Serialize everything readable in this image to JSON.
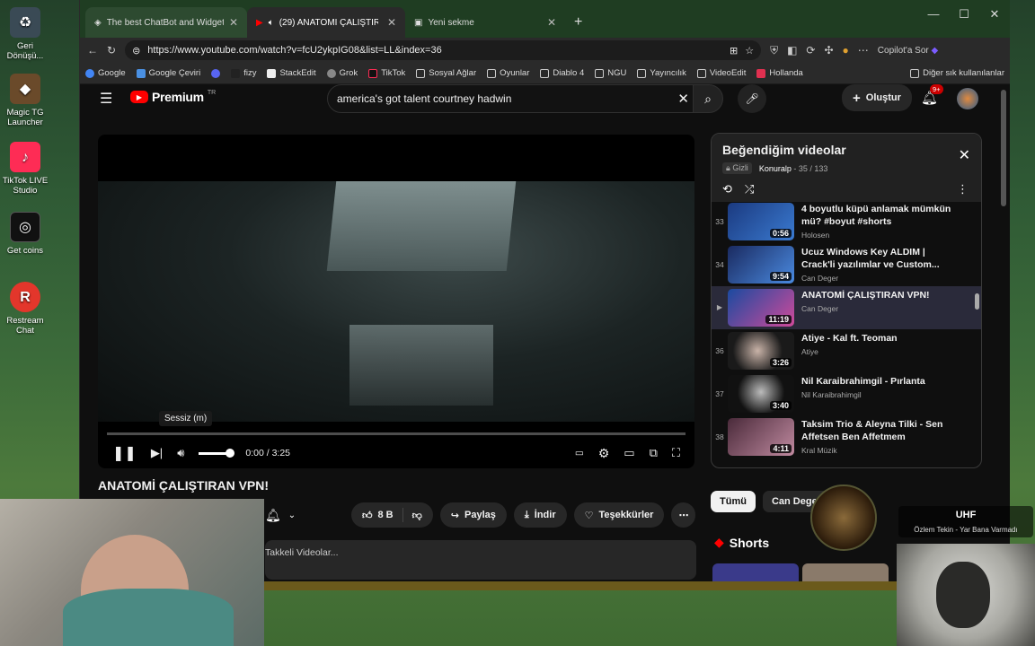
{
  "desktop": {
    "icons": [
      {
        "label": "Geri\nDönüşü...",
        "icon": "recycle-bin-icon"
      },
      {
        "label": "Magic TG\nLauncher",
        "icon": "magic-tg-icon"
      },
      {
        "label": "TikTok LIVE\nStudio",
        "icon": "tiktok-icon"
      },
      {
        "label": "Get coins",
        "icon": "tiktok-coins-icon"
      },
      {
        "label": "Restream\nChat",
        "icon": "restream-icon"
      }
    ]
  },
  "browser": {
    "tabs": [
      {
        "title": "The best ChatBot and Widgets fo"
      },
      {
        "title": "(29) ANATOMİ ÇALIŞTIRAN V"
      },
      {
        "title": "Yeni sekme"
      }
    ],
    "url": "https://www.youtube.com/watch?v=fcU2ykpIG08&list=LL&index=36",
    "copilot": "Copilot'a Sor",
    "bookmarks": [
      "Google",
      "Google Çeviri",
      "fizy",
      "StackEdit",
      "Grok",
      "TikTok",
      "Sosyal Ağlar",
      "Oyunlar",
      "Diablo 4",
      "NGU",
      "Yayıncılık",
      "VideoEdit",
      "Hollanda"
    ],
    "other_bookmarks": "Diğer sık kullanılanlar"
  },
  "youtube": {
    "logo": "Premium",
    "logo_region": "TR",
    "search_query": "america's got talent courtney hadwin",
    "create_label": "Oluştur",
    "notif_badge": "9+",
    "video": {
      "title": "ANATOMİ ÇALIŞTIRAN VPN!",
      "time": "0:00 / 3:25",
      "tooltip": "Sessiz (m)",
      "progress": 0,
      "volume": 0.9
    },
    "actions": {
      "likes": "8 B",
      "share": "Paylaş",
      "download": "İndir",
      "thanks": "Teşekkürler"
    },
    "description_snippet": "Takkeli Videolar...",
    "playlist": {
      "title": "Beğendiğim videolar",
      "privacy": "Gizli",
      "owner": "Konuralp",
      "position": "35 / 133",
      "items": [
        {
          "idx": "33",
          "title": "4 boyutlu küpü anlamak mümkün mü? #boyut #shorts",
          "channel": "Holosen",
          "duration": "0:56",
          "color": "#2a5db0"
        },
        {
          "idx": "34",
          "title": "Ucuz Windows Key ALDIM | Crack'li yazılımlar ve Custom...",
          "channel": "Can Deger",
          "duration": "9:54",
          "color": "#3a6ac8"
        },
        {
          "idx": "▶",
          "title": "ANATOMİ ÇALIŞTIRAN VPN!",
          "channel": "Can Deger",
          "duration": "11:19",
          "color": "#c03a8a"
        },
        {
          "idx": "36",
          "title": "Atiye - Kal ft. Teoman",
          "channel": "Atiye",
          "duration": "3:26",
          "color": "#1a1a1a"
        },
        {
          "idx": "37",
          "title": "Nil Karaibrahimgil - Pırlanta",
          "channel": "Nil Karaibrahimgil",
          "duration": "3:40",
          "color": "#2b2b2b"
        },
        {
          "idx": "38",
          "title": "Taksim Trio & Aleyna Tilki - Sen Affetsen Ben Affetmem",
          "channel": "Kral Müzik",
          "duration": "4:11",
          "color": "#6a3a5a"
        }
      ]
    },
    "chips": [
      "Tümü",
      "Can Deger"
    ],
    "shorts_label": "Shorts"
  },
  "overlay": {
    "now_playing_title": "UHF",
    "now_playing_song": "Özlem Tekin - Yar Bana Varmadı"
  },
  "colors": {
    "yt_red": "#ff0000",
    "accent_blue": "#3ea6ff",
    "active_row": "#2a2a3a"
  }
}
